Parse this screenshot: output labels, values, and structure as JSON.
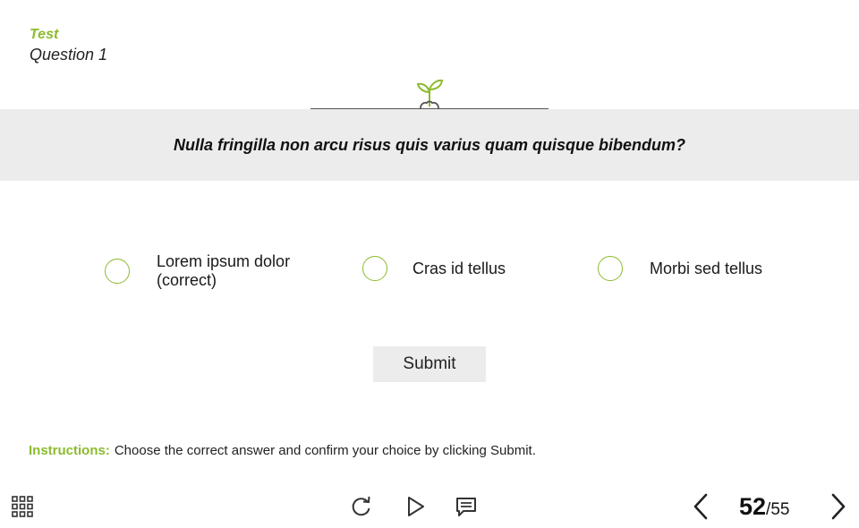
{
  "header": {
    "section": "Test",
    "question_label": "Question 1"
  },
  "question": {
    "text": "Nulla fringilla non arcu risus quis varius quam quisque bibendum?"
  },
  "options": [
    {
      "label": "Lorem ipsum dolor (correct)"
    },
    {
      "label": "Cras id tellus"
    },
    {
      "label": "Morbi sed tellus"
    }
  ],
  "submit": {
    "label": "Submit"
  },
  "instructions": {
    "label": "Instructions:",
    "text": "Choose the correct answer and confirm your choice by clicking Submit."
  },
  "player": {
    "current_slide": "52",
    "total_slides": "/55",
    "icons": [
      "menu-grid-icon",
      "replay-icon",
      "play-icon",
      "notes-icon",
      "chevron-left-icon",
      "chevron-right-icon"
    ]
  },
  "colors": {
    "accent": "#8cbb2e",
    "band": "#ececec",
    "text": "#1a1a1a"
  }
}
